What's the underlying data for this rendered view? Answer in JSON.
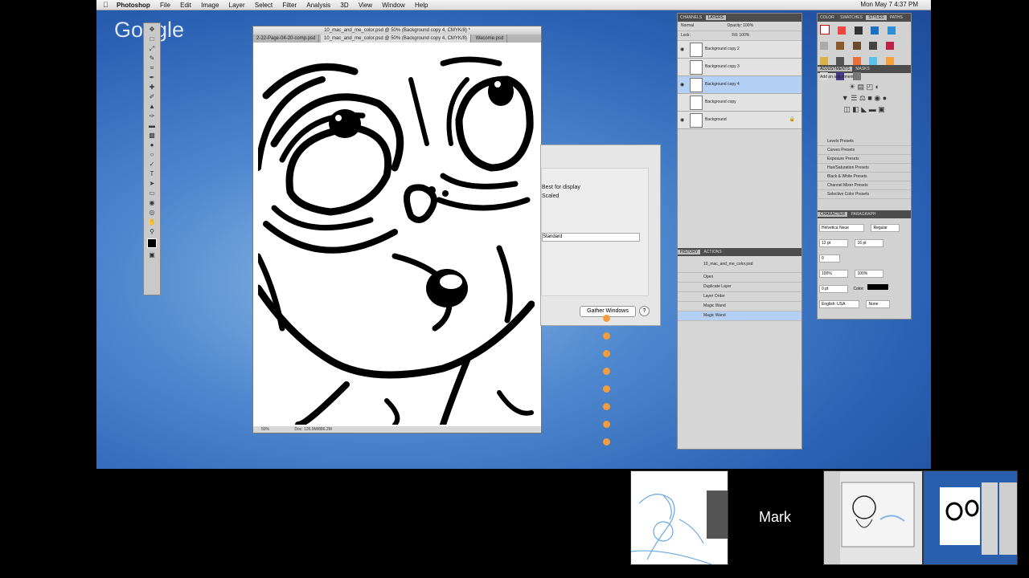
{
  "menubar": {
    "app_name": "Photoshop",
    "items": [
      "File",
      "Edit",
      "Image",
      "Layer",
      "Select",
      "Filter",
      "Analysis",
      "3D",
      "View",
      "Window",
      "Help"
    ],
    "clock": "Mon May 7  4:37 PM"
  },
  "overlay_logo": "Google",
  "document": {
    "title": "10_mac_and_me_color.psd @ 50% (Background copy 4, CMYK/8) *",
    "tabs": [
      "2-22-Page-04-20-comp.psd",
      "10_mac_and_me_color.psd @ 50% (Background copy 4, CMYK/8)",
      "Wacome.psd"
    ],
    "zoom": "50%",
    "doc_size": "Doc: 126.9M/886.2M"
  },
  "dialog": {
    "option_label": "Best for display",
    "scaled_label": "Scaled",
    "select_value": "Standard",
    "gather_button": "Gather Windows",
    "help_button": "?"
  },
  "layers_panel": {
    "tabs": [
      "CHANNELS",
      "LAYERS"
    ],
    "blend_mode": "Normal",
    "opacity_label": "Opacity:",
    "opacity": "100%",
    "lock_label": "Lock:",
    "fill_label": "Fill:",
    "fill": "100%",
    "layers": [
      {
        "name": "Background copy 2",
        "selected": false
      },
      {
        "name": "Background copy 3",
        "selected": false
      },
      {
        "name": "Background copy 4",
        "selected": true
      },
      {
        "name": "Background copy",
        "selected": false
      },
      {
        "name": "Background",
        "selected": false
      }
    ]
  },
  "history_panel": {
    "tabs": [
      "HISTORY",
      "ACTIONS"
    ],
    "snapshot": "10_mac_and_me_color.psd",
    "states": [
      {
        "name": "Open",
        "selected": false
      },
      {
        "name": "Duplicate Layer",
        "selected": false
      },
      {
        "name": "Layer Order",
        "selected": false
      },
      {
        "name": "Magic Wand",
        "selected": false
      },
      {
        "name": "Magic Wand",
        "selected": true
      }
    ]
  },
  "swatches_panel": {
    "tabs": [
      "COLOR",
      "SWATCHES",
      "STYLES",
      "PATHS"
    ]
  },
  "adjustments_panel": {
    "tabs": [
      "ADJUSTMENTS",
      "MASKS"
    ],
    "heading": "Add an adjustment",
    "presets": [
      "Levels Presets",
      "Curves Presets",
      "Exposure Presets",
      "Hue/Saturation Presets",
      "Black & White Presets",
      "Channel Mixer Presets",
      "Selective Color Presets"
    ]
  },
  "character_panel": {
    "tabs": [
      "CHARACTER",
      "PARAGRAPH"
    ],
    "font": "Helvetica Neue",
    "style": "Regular",
    "size": "12 pt",
    "leading": "16 pt",
    "tracking": "0",
    "vscale": "100%",
    "hscale": "100%",
    "baseline": "0 pt",
    "color_label": "Color:",
    "language": "English: USA",
    "aa": "None"
  },
  "participants": {
    "name_tile": "Mark"
  },
  "colors": {
    "desktop": "#4f88cf",
    "selection": "#b5d0f5",
    "dock_icon": "#f39c3c"
  }
}
